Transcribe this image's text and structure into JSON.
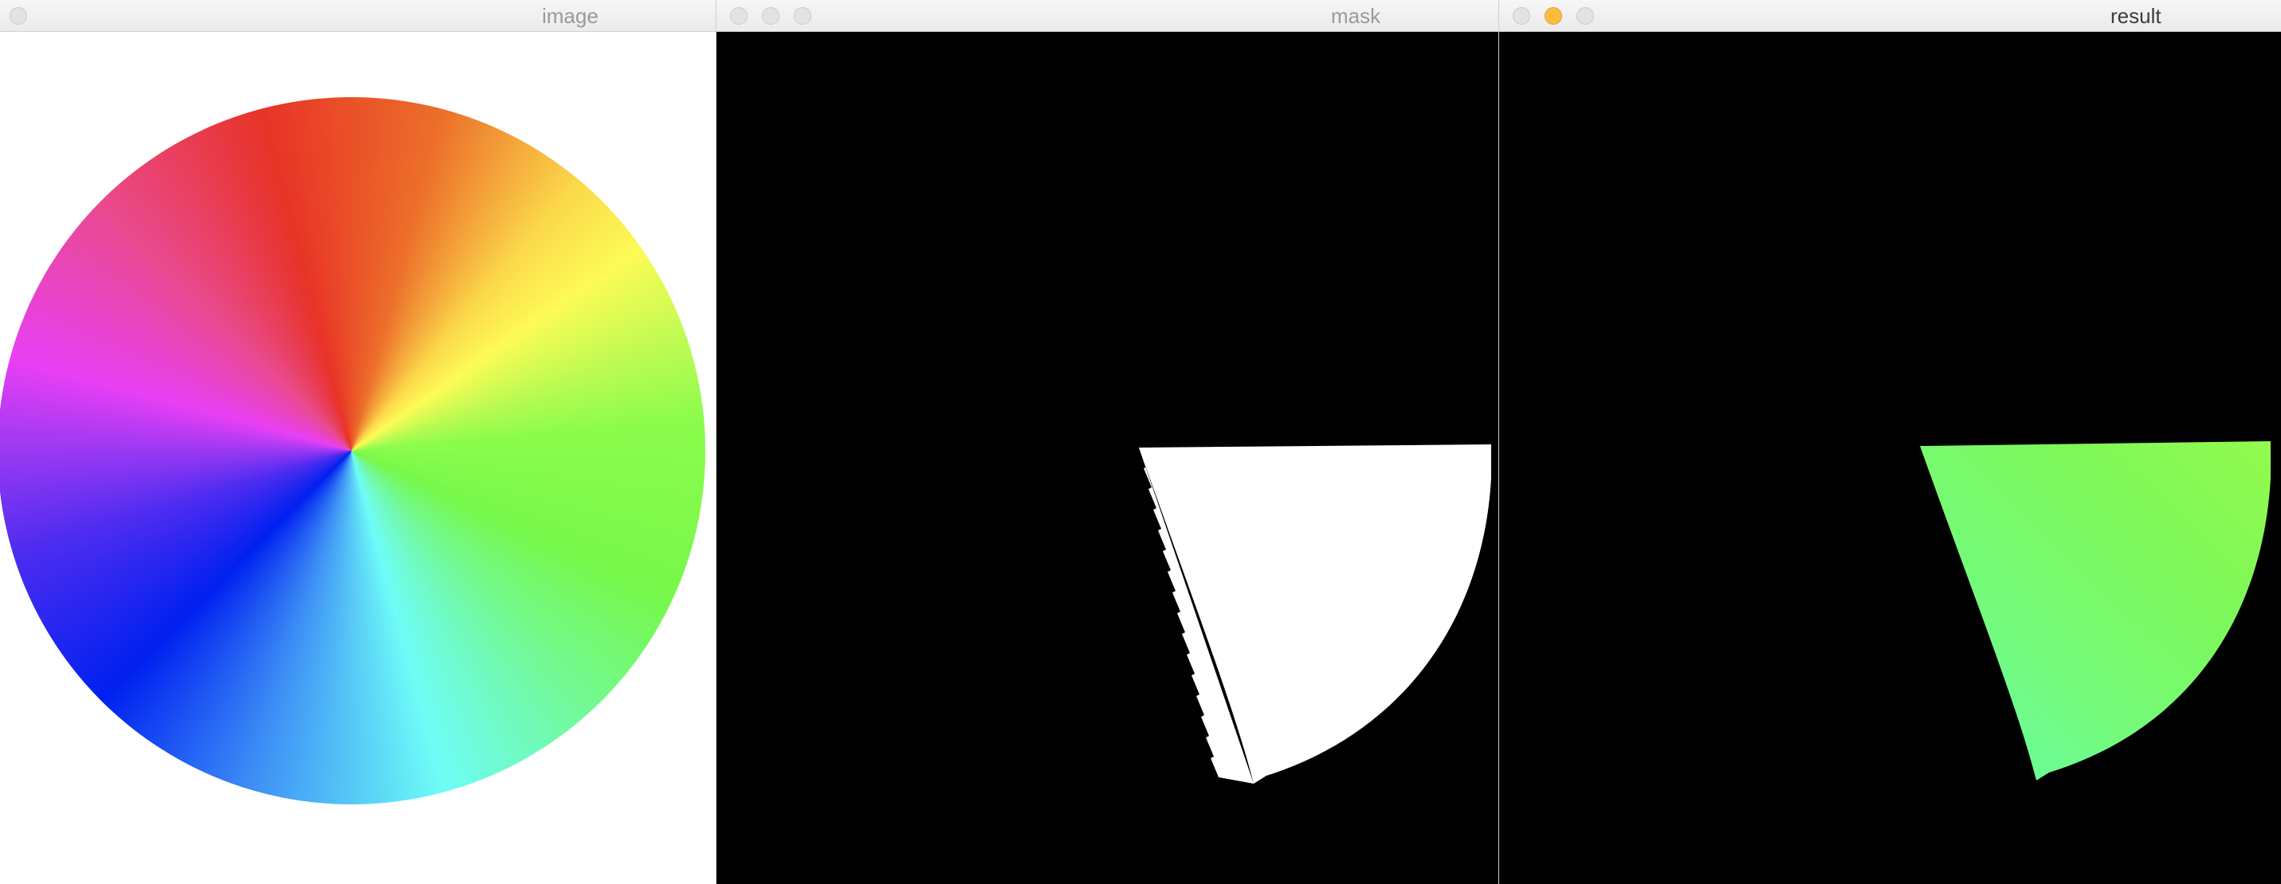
{
  "windows": [
    {
      "title": "image",
      "controls": [
        "close-button"
      ],
      "content": "hue-color-wheel"
    },
    {
      "title": "mask",
      "controls": [
        "close-button",
        "minimize-button",
        "zoom-button"
      ],
      "content": "binary-mask"
    },
    {
      "title": "result",
      "controls": [
        "close-button",
        "minimize-button",
        "zoom-button"
      ],
      "active_control": "minimize-button",
      "content": "masked-result"
    }
  ],
  "colors": {
    "titlebar": "#ececec",
    "control_inactive": "#e3e3e3",
    "control_active_yellow": "#fdbc40",
    "mask_background": "#000000",
    "mask_foreground": "#ffffff",
    "result_green": "#8cfc4c",
    "result_cyan": "#66fca6"
  },
  "wheel_hues": [
    "red",
    "orange",
    "yellow",
    "green",
    "cyan",
    "blue",
    "violet",
    "magenta"
  ]
}
